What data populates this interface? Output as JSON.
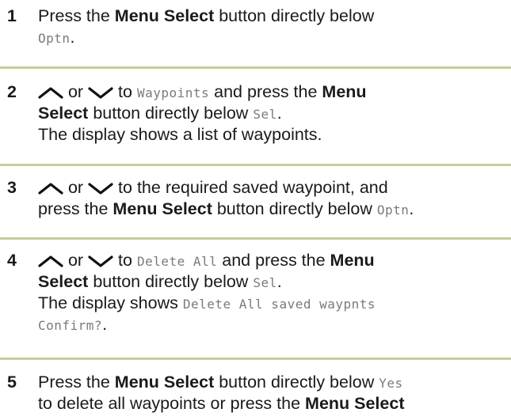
{
  "steps": [
    {
      "number": "1",
      "lines": [
        [
          "Press the ",
          {
            "b": "Menu Select"
          },
          " button directly below"
        ],
        [
          {
            "lcd": "Optn"
          },
          "."
        ]
      ]
    },
    {
      "number": "2",
      "lines": [
        [
          {
            "icon": "up-arrow-icon"
          },
          " or ",
          {
            "icon": "down-arrow-icon"
          },
          " to ",
          {
            "lcd": "Waypoints"
          },
          " and press the ",
          {
            "b": "Menu"
          }
        ],
        [
          {
            "b": "Select"
          },
          " button directly below ",
          {
            "lcd": "Sel"
          },
          "."
        ],
        [
          "The display shows a list of waypoints."
        ]
      ]
    },
    {
      "number": "3",
      "lines": [
        [
          {
            "icon": "up-arrow-icon"
          },
          " or ",
          {
            "icon": "down-arrow-icon"
          },
          " to the required saved waypoint, and"
        ],
        [
          "press the ",
          {
            "b": "Menu Select"
          },
          " button directly below ",
          {
            "lcd": "Optn"
          },
          "."
        ]
      ]
    },
    {
      "number": "4",
      "lines": [
        [
          {
            "icon": "up-arrow-icon"
          },
          " or ",
          {
            "icon": "down-arrow-icon"
          },
          " to ",
          {
            "lcd": "Delete All"
          },
          " and press the ",
          {
            "b": "Menu"
          }
        ],
        [
          {
            "b": "Select"
          },
          " button directly below ",
          {
            "lcd": "Sel"
          },
          "."
        ],
        [
          "The display shows ",
          {
            "lcd": "Delete All saved waypnts"
          }
        ],
        [
          {
            "lcd": "Confirm?"
          },
          "."
        ]
      ]
    },
    {
      "number": "5",
      "lines": [
        [
          "Press the ",
          {
            "b": "Menu Select"
          },
          " button directly below ",
          {
            "lcd": "Yes"
          }
        ],
        [
          "to delete all waypoints or press the ",
          {
            "b": "Menu Select"
          }
        ]
      ]
    }
  ],
  "colors": {
    "divider": "#c9cc9a",
    "lcd_text": "#7a7a7a",
    "body_text": "#1a1a1a"
  }
}
